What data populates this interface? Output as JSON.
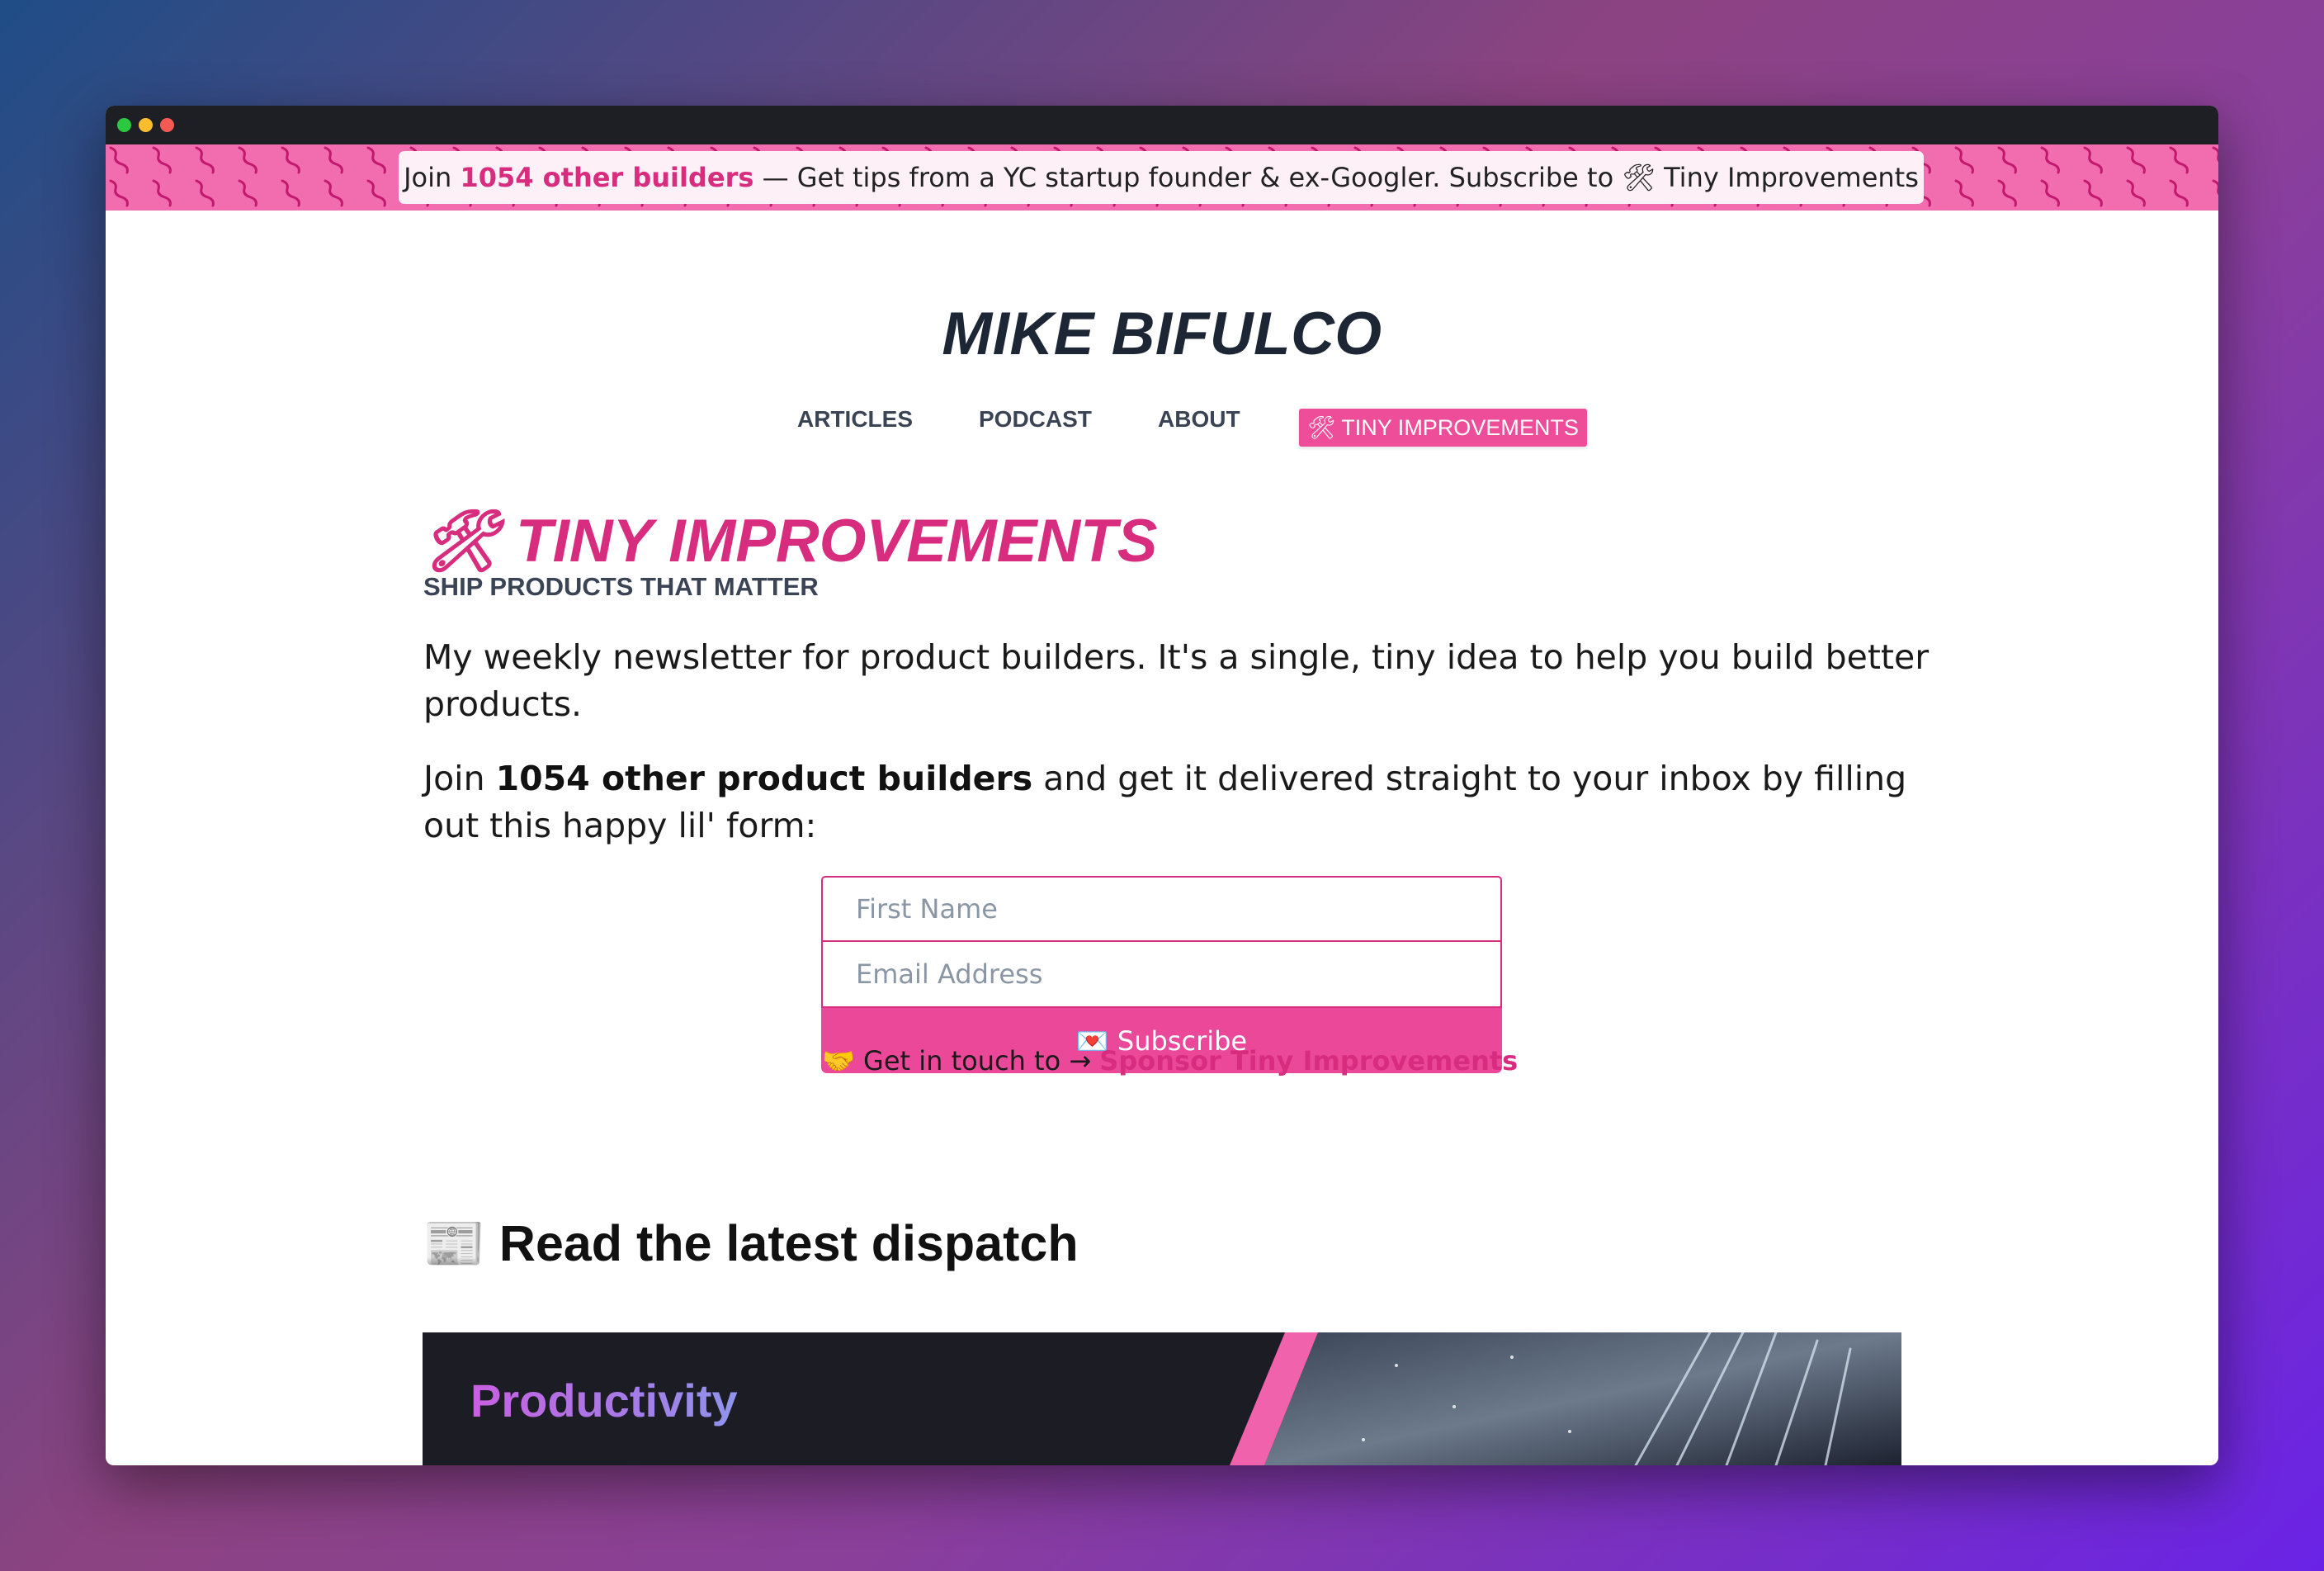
{
  "banner": {
    "join": "Join ",
    "count": "1054 other builders",
    "rest": " — Get tips from a YC startup founder & ex-Googler. Subscribe to ",
    "icon": "tool-icon",
    "newsletter": " Tiny Improvements"
  },
  "site": {
    "title": "MIKE BIFULCO"
  },
  "nav": {
    "items": [
      {
        "label": "ARTICLES"
      },
      {
        "label": "PODCAST"
      },
      {
        "label": "ABOUT"
      },
      {
        "label": "TINY IMPROVEMENTS",
        "icon": "tool-icon"
      }
    ]
  },
  "hero": {
    "title": "TINY IMPROVEMENTS",
    "title_icon": "tool-icon",
    "tagline": "SHIP PRODUCTS THAT MATTER",
    "intro": "My weekly newsletter for product builders. It's a single, tiny idea to help you build better products.",
    "join_prefix": "Join ",
    "join_count": "1054 other product builders",
    "join_suffix": " and get it delivered straight to your inbox by filling out this happy lil' form:"
  },
  "form": {
    "first_name_placeholder": "First Name",
    "email_placeholder": "Email Address",
    "subscribe_label": "Subscribe",
    "subscribe_icon": "mail-icon"
  },
  "sponsor": {
    "icon": "handshake-icon",
    "text": " Get in touch to → ",
    "link": "Sponsor Tiny Improvements"
  },
  "latest": {
    "icon": "newspaper-icon",
    "heading": "Read the latest dispatch",
    "card_label": "Productivity"
  },
  "colors": {
    "accent": "#d82c7f",
    "button": "#ec4899",
    "banner": "#f26db0",
    "text_dark": "#1c2634"
  }
}
